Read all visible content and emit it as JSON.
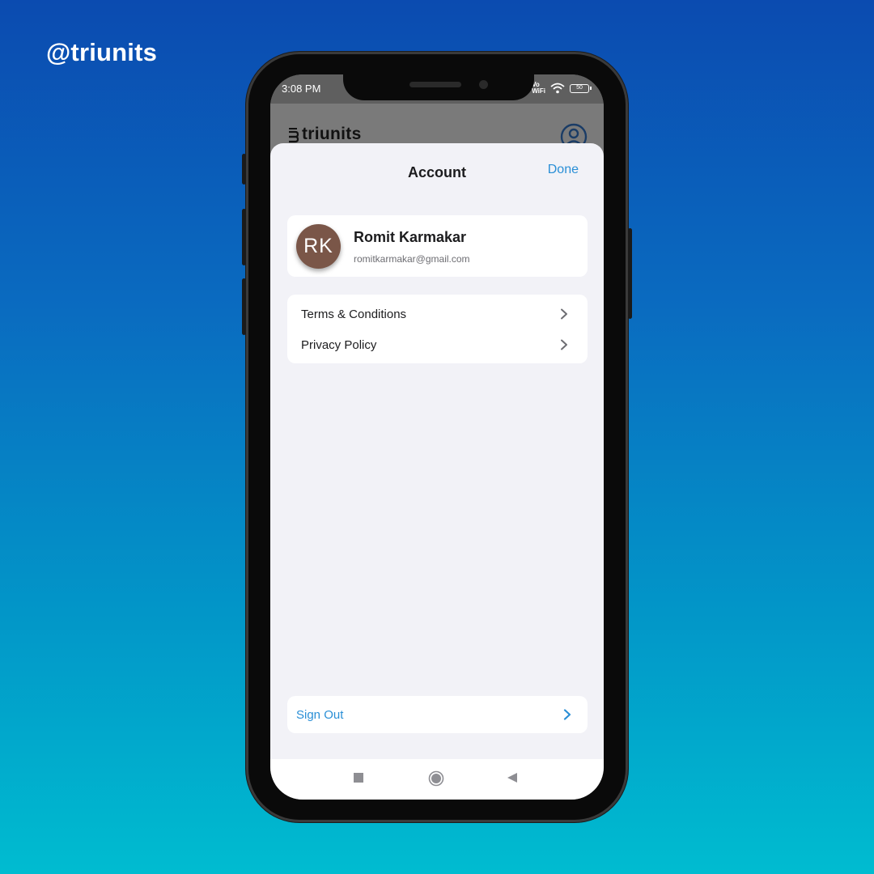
{
  "overlay": {
    "handle": "@triunits"
  },
  "status_bar": {
    "time": "3:08 PM",
    "vowifi_line1": "Vo",
    "vowifi_line2": "WiFi",
    "battery": "50"
  },
  "app_bar": {
    "logo_text": "triunits"
  },
  "sheet": {
    "title": "Account",
    "done_label": "Done"
  },
  "profile": {
    "initials": "RK",
    "name": "Romit Karmakar",
    "email": "romitkarmakar@gmail.com",
    "avatar_color": "#7a5648"
  },
  "links": [
    {
      "label": "Terms & Conditions",
      "icon": "chevron-right-icon"
    },
    {
      "label": "Privacy Policy",
      "icon": "chevron-right-icon"
    }
  ],
  "sign_out": {
    "label": "Sign Out",
    "icon": "chevron-right-icon"
  },
  "nav_bar": {
    "buttons": [
      "recents-square-icon",
      "home-circle-icon",
      "back-triangle-icon"
    ]
  },
  "colors": {
    "accent": "#2a8fd6",
    "sheet_bg": "#f2f2f7",
    "card_bg": "#ffffff",
    "text_primary": "#1c1c1e",
    "text_secondary": "#6d6d72"
  }
}
